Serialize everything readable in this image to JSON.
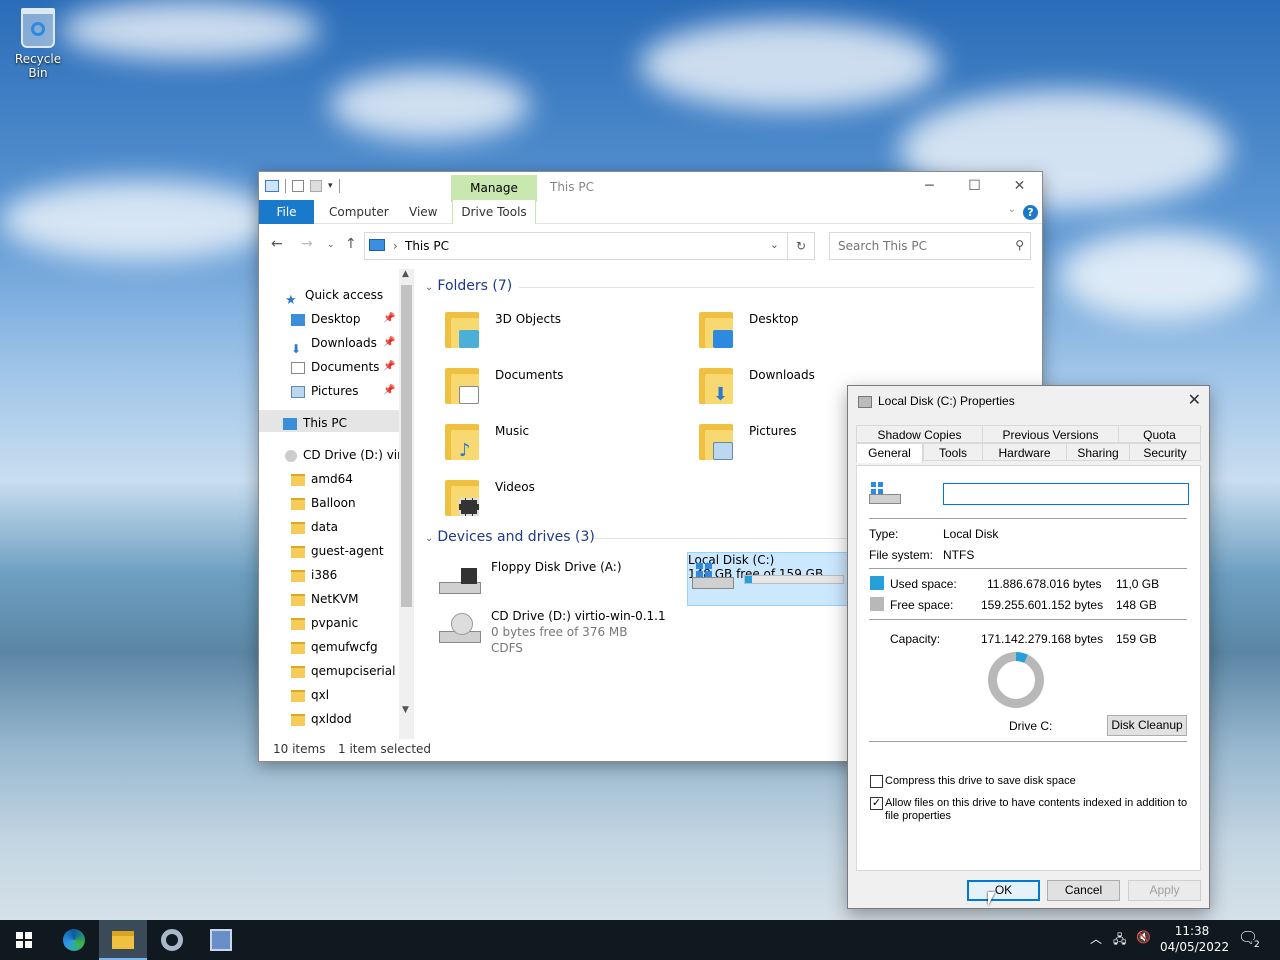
{
  "desktop": {
    "recycle_bin_label": "Recycle Bin"
  },
  "explorer": {
    "title": "This PC",
    "ribbon_tabs": {
      "file": "File",
      "computer": "Computer",
      "view": "View",
      "manage": "Manage",
      "drive_tools": "Drive Tools"
    },
    "help_glyph": "?",
    "address": {
      "path": "This PC",
      "separator": "›"
    },
    "search": {
      "placeholder": "Search This PC"
    },
    "nav": {
      "quick_access": "Quick access",
      "pinned": [
        "Desktop",
        "Downloads",
        "Documents",
        "Pictures"
      ],
      "this_pc": "This PC",
      "cd_drive": "CD Drive (D:) virtio",
      "cd_folders": [
        "amd64",
        "Balloon",
        "data",
        "guest-agent",
        "i386",
        "NetKVM",
        "pvpanic",
        "qemufwcfg",
        "qemupciserial",
        "qxl",
        "qxldod"
      ]
    },
    "folders_group": "Folders (7)",
    "folders": [
      "3D Objects",
      "Desktop",
      "Documents",
      "Downloads",
      "Music",
      "Pictures",
      "Videos"
    ],
    "devices_group": "Devices and drives (3)",
    "drives": {
      "floppy": {
        "name": "Floppy Disk Drive (A:)"
      },
      "local": {
        "name": "Local Disk (C:)",
        "free": "148 GB free of 159 GB",
        "used_fraction": 0.07
      },
      "cd": {
        "name": "CD Drive (D:) virtio-win-0.1.1",
        "free": "0 bytes free of 376 MB",
        "fs": "CDFS"
      }
    },
    "status": {
      "items": "10 items",
      "selected": "1 item selected"
    }
  },
  "properties": {
    "title": "Local Disk (C:) Properties",
    "tabs_top": [
      "Shadow Copies",
      "Previous Versions",
      "Quota"
    ],
    "tabs_bottom": [
      "General",
      "Tools",
      "Hardware",
      "Sharing",
      "Security"
    ],
    "name_value": "",
    "type_label": "Type:",
    "type_value": "Local Disk",
    "fs_label": "File system:",
    "fs_value": "NTFS",
    "used_label": "Used space:",
    "used_bytes": "11.886.678.016 bytes",
    "used_gb": "11,0 GB",
    "free_label": "Free space:",
    "free_bytes": "159.255.601.152 bytes",
    "free_gb": "148 GB",
    "capacity_label": "Capacity:",
    "capacity_bytes": "171.142.279.168 bytes",
    "capacity_gb": "159 GB",
    "drive_label": "Drive C:",
    "disk_cleanup": "Disk Cleanup",
    "compress_label": "Compress this drive to save disk space",
    "compress_checked": false,
    "index_label_1": "Allow files on this drive to have contents indexed in addition to",
    "index_label_2": "file properties",
    "index_checked": true,
    "ok": "OK",
    "cancel": "Cancel",
    "apply": "Apply",
    "colors": {
      "used": "#26a0da",
      "free": "#b8b8b8"
    }
  },
  "taskbar": {
    "time": "11:38",
    "date": "04/05/2022",
    "notification_count": "2",
    "apps": [
      "start-icon",
      "edge-icon",
      "file-explorer-icon",
      "settings-icon",
      "server-manager-icon"
    ]
  }
}
